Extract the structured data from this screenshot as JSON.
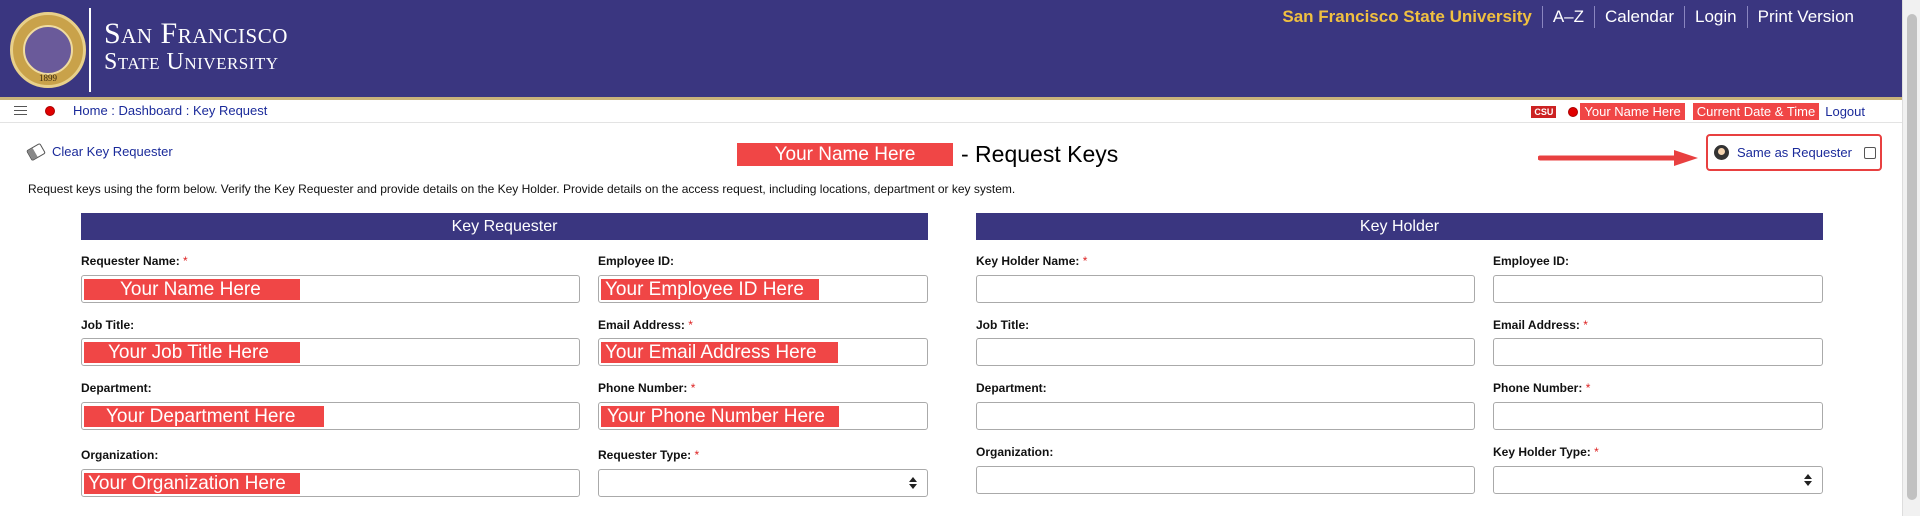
{
  "header": {
    "logo_line1": "San Francisco",
    "logo_line2": "State University",
    "seal_year": "1899",
    "nav": [
      "San Francisco State University",
      "A–Z",
      "Calendar",
      "Login",
      "Print Version"
    ]
  },
  "crumbbar": {
    "breadcrumb": "Home : Dashboard : Key Request",
    "csu_badge": "CSU",
    "user_name": "Your Name Here",
    "datetime": "Current Date & Time",
    "logout": "Logout"
  },
  "toolbar": {
    "clear_label": "Clear Key Requester",
    "title_name": "Your Name Here",
    "title_suffix": "- Request Keys",
    "same_as_label": "Same as Requester"
  },
  "instructions": "Request keys using the form below. Verify the Key Requester and provide details on the Key Holder. Provide details on the access request, including locations, department or key system.",
  "requester": {
    "heading": "Key Requester",
    "name_label": "Requester Name:",
    "name_value": "Your Name Here",
    "empid_label": "Employee ID:",
    "empid_value": "Your Employee ID Here",
    "job_label": "Job Title:",
    "job_value": "Your Job Title Here",
    "email_label": "Email Address:",
    "email_value": "Your Email Address Here",
    "dept_label": "Department:",
    "dept_value": "Your Department Here",
    "phone_label": "Phone Number:",
    "phone_value": "Your Phone Number Here",
    "org_label": "Organization:",
    "org_value": "Your Organization Here",
    "type_label": "Requester Type:",
    "type_value": ""
  },
  "holder": {
    "heading": "Key Holder",
    "name_label": "Key Holder Name:",
    "empid_label": "Employee ID:",
    "job_label": "Job Title:",
    "email_label": "Email Address:",
    "dept_label": "Department:",
    "phone_label": "Phone Number:",
    "org_label": "Organization:",
    "type_label": "Key Holder Type:"
  },
  "required_mark": "*",
  "colors": {
    "header_bg": "#3a3680",
    "accent_gold": "#f0c040",
    "highlight_red": "#f04646",
    "link_blue": "#1a2a9a"
  }
}
